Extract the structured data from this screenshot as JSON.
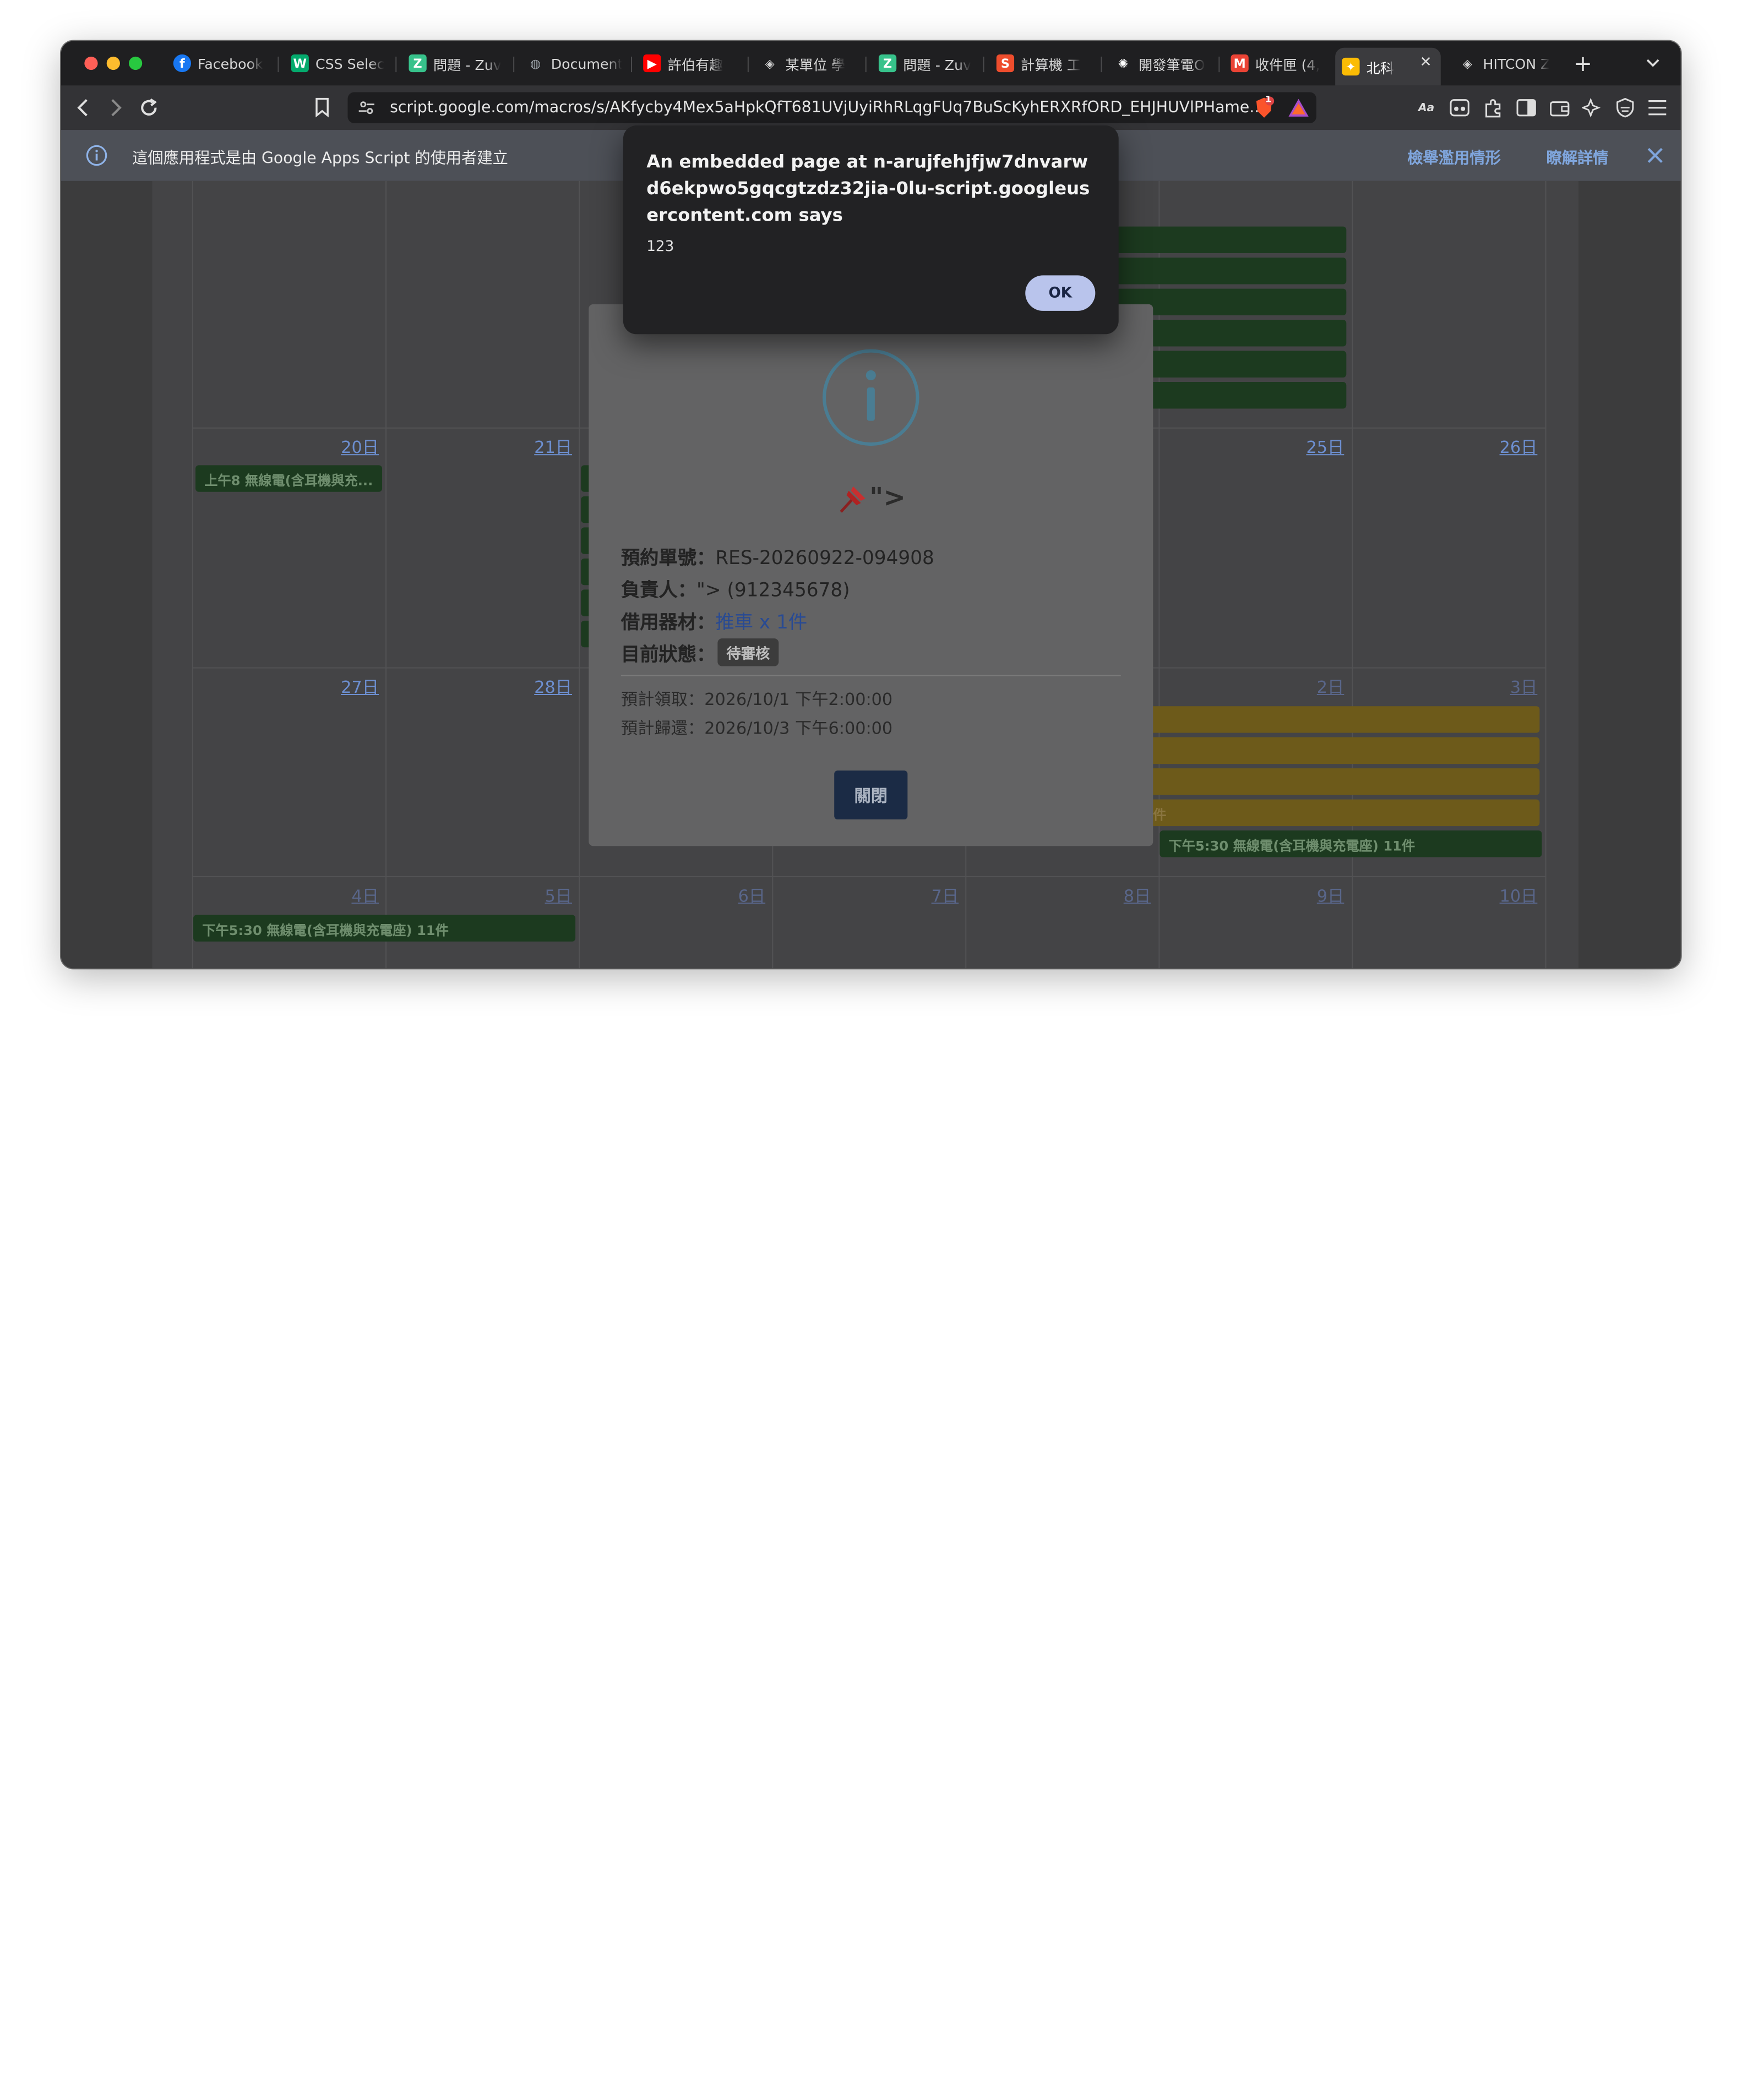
{
  "browser": {
    "tabs": [
      {
        "title": "Facebook",
        "icon": "facebook-icon",
        "color": "#1877f2"
      },
      {
        "title": "CSS Selec",
        "icon": "w3schools-icon",
        "color": "#04aa6d"
      },
      {
        "title": "問題 - Zuv",
        "icon": "zuvio-icon",
        "color": "#37c28b"
      },
      {
        "title": "Document",
        "icon": "globe-icon",
        "color": "#9aa0a6"
      },
      {
        "title": "許伯有趣",
        "icon": "youtube-icon",
        "color": "#ff0000"
      },
      {
        "title": "某單位 學",
        "icon": "vercel-icon",
        "color": "#cfcfcf"
      },
      {
        "title": "問題 - Zuv",
        "icon": "zuvio-icon",
        "color": "#37c28b"
      },
      {
        "title": "計算機 工",
        "icon": "shopee-icon",
        "color": "#ee4d2d"
      },
      {
        "title": "開發筆電O",
        "icon": "openai-icon",
        "color": "#ffffff"
      },
      {
        "title": "收件匣 (4,",
        "icon": "gmail-icon",
        "color": "#ea4335"
      },
      {
        "title": "北科",
        "icon": "apps-script-icon",
        "color": "#fbbc04",
        "active": true
      },
      {
        "title": "HITCON Z",
        "icon": "vercel-icon",
        "color": "#cfcfcf"
      }
    ],
    "url": "script.google.com/macros/s/AKfycby4Mex5aHpkQfT681UVjUyiRhRLqgFUq7BuScKyhERXRfORD_EHJHUVlPHame...",
    "shield_badge": "1"
  },
  "infobar": {
    "text": "這個應用程式是由 Google Apps Script 的使用者建立",
    "report_link": "檢舉濫用情形",
    "learn_more_link": "瞭解詳情"
  },
  "calendar": {
    "row3": {
      "d20": "20日",
      "d21": "21日",
      "d25": "25日",
      "d26": "26日"
    },
    "row4": {
      "d27": "27日",
      "d28": "28日",
      "d2": "2日",
      "d3": "3日"
    },
    "row5": {
      "d4": "4日",
      "d5": "5日",
      "d6": "6日",
      "d7": "7日",
      "d8": "8日",
      "d9": "9日",
      "d10": "10日"
    },
    "event_a": "上午8 無線電(含耳機與充...",
    "event_b": "下午5:30 無線電(含耳機與充電座) 11件",
    "event_c": "下午5:30 無線電(含耳機與充電座) 11件",
    "event_tail": "件"
  },
  "modal": {
    "icon": "info-circle-icon",
    "heading": "\">",
    "order_label": "預約單號：",
    "order_value": "RES-20260922-094908",
    "owner_label": "負責人：",
    "owner_value": "\"> (912345678)",
    "equipment_label": "借用器材：",
    "equipment_value": "推車 x 1件",
    "status_label": "目前狀態：",
    "status_value": "待審核",
    "pickup_label": "預計領取：",
    "pickup_value": "2026/10/1 下午2:00:00",
    "return_label": "預計歸還：",
    "return_value": "2026/10/3 下午6:00:00",
    "close_button": "關閉"
  },
  "alert": {
    "title": "An embedded page at n-arujfehjfjw7dnvarwd6ekpwo5gqcgtzdz32jia-0lu-script.googleusercontent.com says",
    "message": "123",
    "ok_button": "OK"
  }
}
